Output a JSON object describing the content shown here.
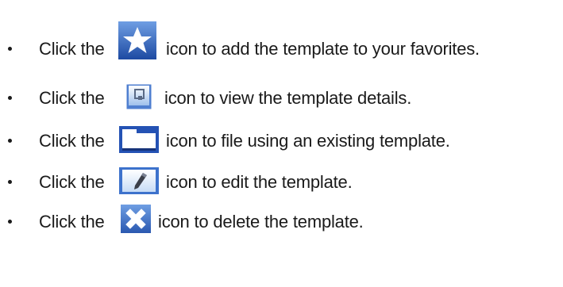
{
  "items": [
    {
      "before": "Click the",
      "icon": "favorite-star-icon",
      "after": "icon to add the template to your favorites."
    },
    {
      "before": "Click the",
      "icon": "view-details-icon",
      "after": "icon to view the template details."
    },
    {
      "before": "Click the",
      "icon": "folder-icon",
      "after": "icon to file using an existing template."
    },
    {
      "before": "Click the",
      "icon": "edit-pencil-icon",
      "after": "icon to edit the template."
    },
    {
      "before": "Click the",
      "icon": "delete-x-icon",
      "after": "icon to delete the template."
    }
  ],
  "colors": {
    "text": "#1a1a1a",
    "icon_blue_dark": "#1f4fa8",
    "icon_blue_light": "#5f8fd8",
    "icon_gray": "#c9ced6"
  }
}
